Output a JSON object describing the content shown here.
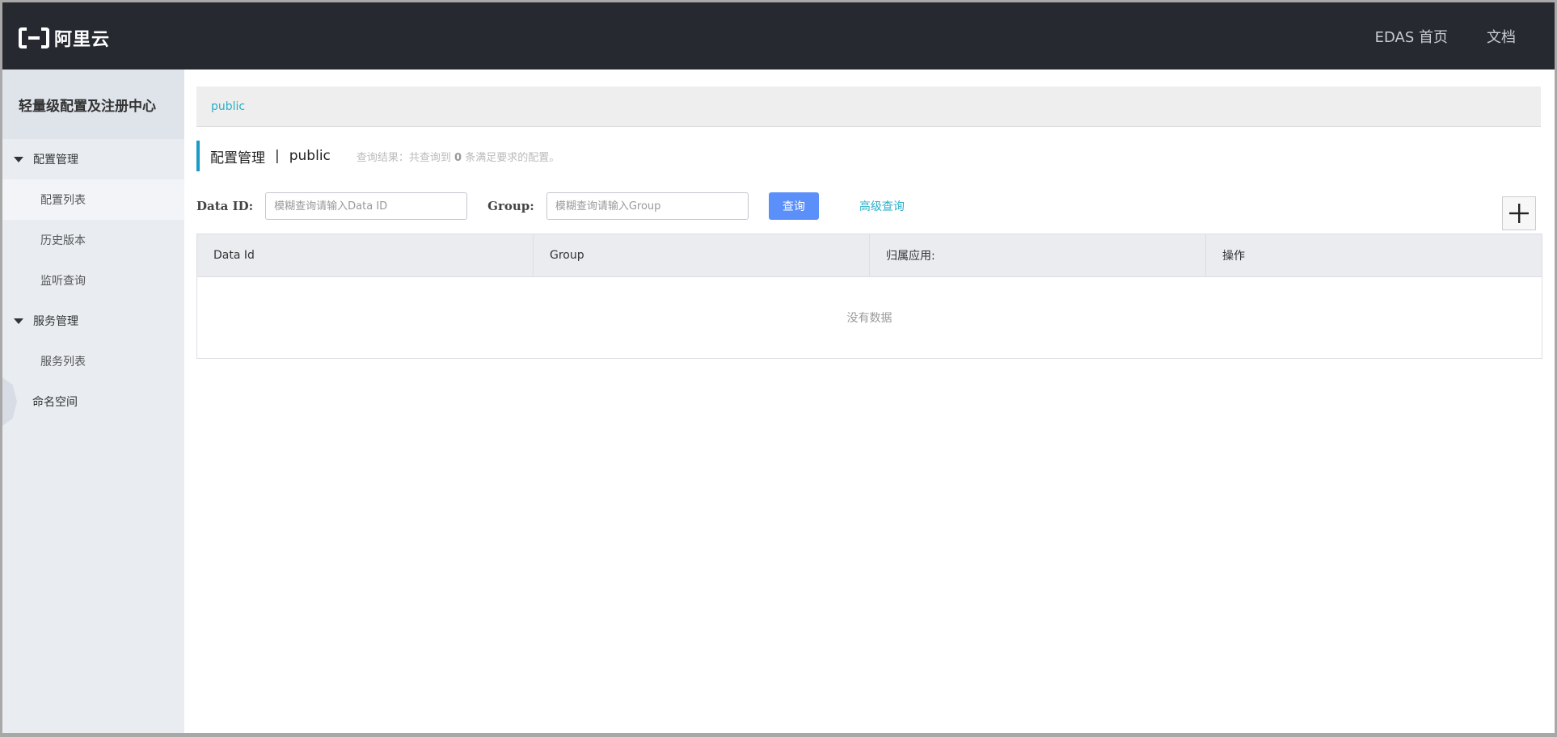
{
  "header": {
    "logo_text": "阿里云",
    "nav": [
      "EDAS 首页",
      "文档"
    ]
  },
  "sidebar": {
    "title": "轻量级配置及注册中心",
    "groups": [
      {
        "label": "配置管理",
        "items": [
          "配置列表",
          "历史版本",
          "监听查询"
        ]
      },
      {
        "label": "服务管理",
        "items": [
          "服务列表"
        ]
      }
    ],
    "namespace_label": "命名空间"
  },
  "breadcrumb": {
    "namespace": "public"
  },
  "page": {
    "title": "配置管理",
    "separator": "|",
    "namespace": "public",
    "query_result_prefix": "查询结果：共查询到",
    "query_result_count": "0",
    "query_result_suffix": "条满足要求的配置。"
  },
  "search": {
    "data_id_label": "Data ID:",
    "data_id_placeholder": "模糊查询请输入Data ID",
    "group_label": "Group:",
    "group_placeholder": "模糊查询请输入Group",
    "query_button": "查询",
    "advanced_link": "高级查询"
  },
  "table": {
    "columns": [
      "Data Id",
      "Group",
      "归属应用:",
      "操作"
    ],
    "empty_text": "没有数据"
  },
  "colors": {
    "topbar": "#262a30",
    "accent": "#2bb0c8",
    "primary_button": "#5b8ff9"
  }
}
